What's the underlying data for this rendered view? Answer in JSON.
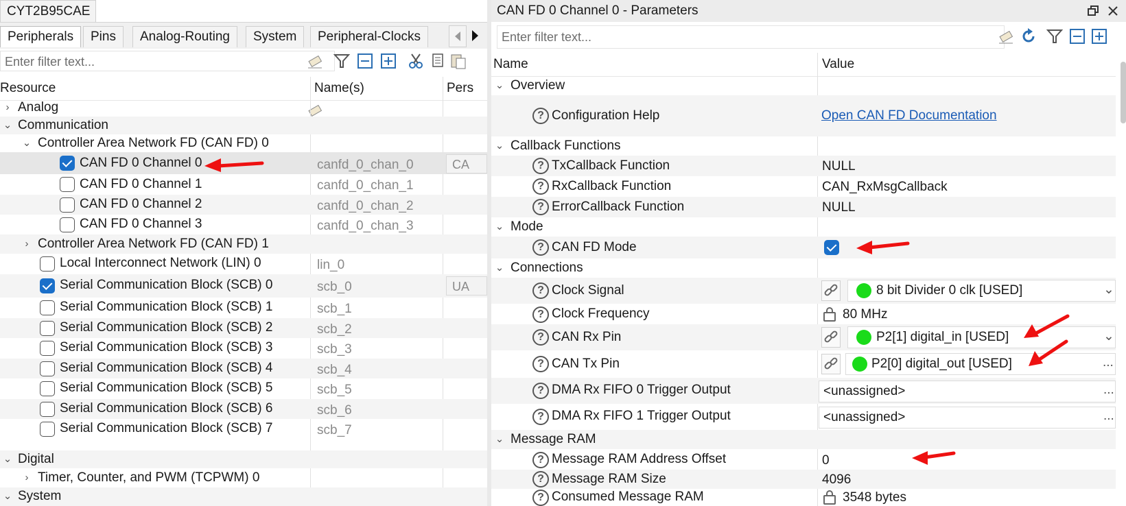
{
  "left": {
    "doc_tab": "CYT2B95CAE",
    "tabs": [
      "Peripherals",
      "Pins",
      "Analog-Routing",
      "System",
      "Peripheral-Clocks"
    ],
    "filter_placeholder": "Enter filter text...",
    "columns": [
      "Resource",
      "Name(s)",
      "Pers"
    ],
    "tree": {
      "analog": "Analog",
      "communication": "Communication",
      "canfd0": "Controller Area Network FD (CAN FD) 0",
      "ch0": "CAN FD 0 Channel 0",
      "ch0_name": "canfd_0_chan_0",
      "ch0_pers": "CA",
      "ch1": "CAN FD 0 Channel 1",
      "ch1_name": "canfd_0_chan_1",
      "ch2": "CAN FD 0 Channel 2",
      "ch2_name": "canfd_0_chan_2",
      "ch3": "CAN FD 0 Channel 3",
      "ch3_name": "canfd_0_chan_3",
      "canfd1": "Controller Area Network FD (CAN FD) 1",
      "lin0": "Local Interconnect Network (LIN) 0",
      "lin0_name": "lin_0",
      "scb0": "Serial Communication Block (SCB) 0",
      "scb0_name": "scb_0",
      "scb0_pers": "UA",
      "scb1": "Serial Communication Block (SCB) 1",
      "scb1_name": "scb_1",
      "scb2": "Serial Communication Block (SCB) 2",
      "scb2_name": "scb_2",
      "scb3": "Serial Communication Block (SCB) 3",
      "scb3_name": "scb_3",
      "scb4": "Serial Communication Block (SCB) 4",
      "scb4_name": "scb_4",
      "scb5": "Serial Communication Block (SCB) 5",
      "scb5_name": "scb_5",
      "scb6": "Serial Communication Block (SCB) 6",
      "scb6_name": "scb_6",
      "scb7": "Serial Communication Block (SCB) 7",
      "scb7_name": "scb_7",
      "digital": "Digital",
      "tcpwm": "Timer, Counter, and PWM (TCPWM) 0",
      "system": "System"
    }
  },
  "right": {
    "title": "CAN FD 0 Channel 0 - Parameters",
    "filter_placeholder": "Enter filter text...",
    "columns": [
      "Name",
      "Value"
    ],
    "overview": "Overview",
    "config_help": "Configuration Help",
    "config_help_link": "Open CAN FD Documentation",
    "callbacks": "Callback Functions",
    "tx_cb": "TxCallback Function",
    "tx_cb_val": "NULL",
    "rx_cb": "RxCallback Function",
    "rx_cb_val": "CAN_RxMsgCallback",
    "err_cb": "ErrorCallback Function",
    "err_cb_val": "NULL",
    "mode": "Mode",
    "canfd_mode": "CAN FD Mode",
    "connections": "Connections",
    "clock_signal": "Clock Signal",
    "clock_signal_val": "8 bit Divider 0 clk [USED]",
    "clock_freq": "Clock Frequency",
    "clock_freq_val": "80 MHz",
    "rx_pin": "CAN Rx Pin",
    "rx_pin_val": "P2[1] digital_in [USED]",
    "tx_pin": "CAN Tx Pin",
    "tx_pin_val": "P2[0] digital_out [USED]",
    "dma0": "DMA Rx FIFO 0 Trigger Output",
    "dma0_val": "<unassigned>",
    "dma1": "DMA Rx FIFO 1 Trigger Output",
    "dma1_val": "<unassigned>",
    "msg_ram": "Message RAM",
    "ram_offset": "Message RAM Address Offset",
    "ram_offset_val": "0",
    "ram_size": "Message RAM Size",
    "ram_size_val": "4096",
    "consumed_ram": "Consumed Message RAM",
    "consumed_ram_val": "3548 bytes",
    "ellipsis": "..."
  },
  "colors": {
    "accent": "#1a6fc9",
    "used_dot": "#1adb1a",
    "annotation_arrow": "#ee1111",
    "link": "#1a5bb5"
  }
}
